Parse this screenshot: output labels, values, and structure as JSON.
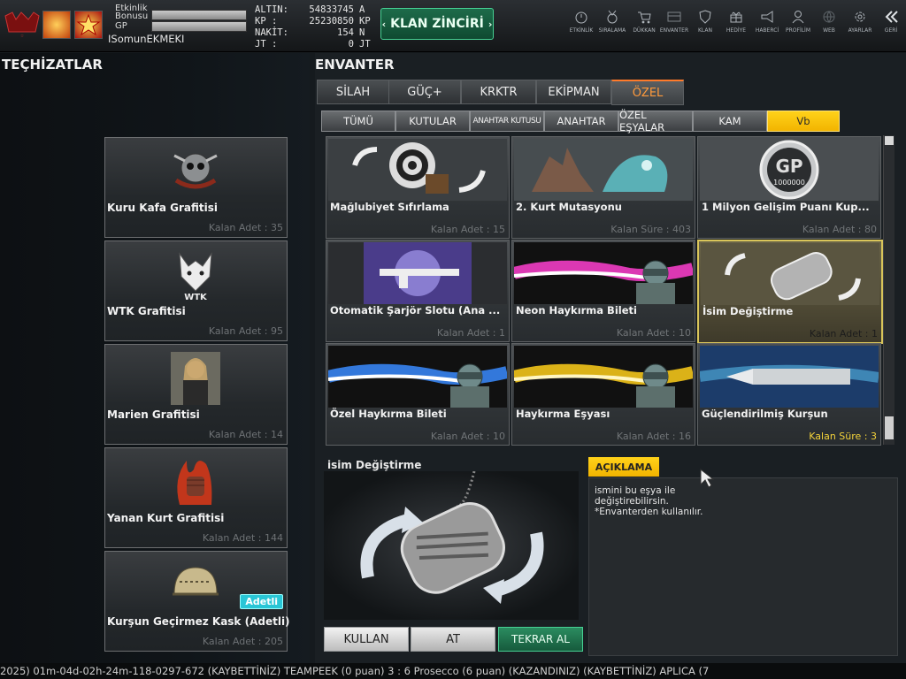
{
  "player": {
    "name": "ISomunEKMEKI",
    "bonus_label_1": "Etkinlik",
    "bonus_label_2": "Bonusu",
    "gp_label": "GP"
  },
  "currency": [
    {
      "label": "ALTIN:",
      "value": "54833745",
      "unit": "A"
    },
    {
      "label": "KP :",
      "value": "25230850",
      "unit": "KP"
    },
    {
      "label": "NAKİT:",
      "value": "154",
      "unit": "N"
    },
    {
      "label": "JT :",
      "value": "0",
      "unit": "JT"
    }
  ],
  "klan_button": {
    "label": "KLAN ZİNCİRİ"
  },
  "nav": [
    {
      "label": "ETKİNLİK",
      "icon": "stopwatch-icon"
    },
    {
      "label": "SIRALAMA",
      "icon": "medal-icon"
    },
    {
      "label": "DÜKKAN",
      "icon": "cart-icon"
    },
    {
      "label": "ENVANTER",
      "icon": "inventory-icon"
    },
    {
      "label": "KLAN",
      "icon": "shield-icon"
    },
    {
      "label": "HEDİYE",
      "icon": "gift-icon"
    },
    {
      "label": "HABERCİ",
      "icon": "megaphone-icon"
    },
    {
      "label": "PROFİLİM",
      "icon": "profile-icon"
    },
    {
      "label": "WEB",
      "icon": "globe-icon"
    },
    {
      "label": "AYARLAR",
      "icon": "gear-icon"
    },
    {
      "label": "GERİ",
      "icon": "back-icon"
    }
  ],
  "left": {
    "title": "TEÇHİZATLAR",
    "items": [
      {
        "name": "Kuru Kafa Grafitisi",
        "qty": "Kalan Adet : 35",
        "icon": "skull-icon"
      },
      {
        "name": "WTK Grafitisi",
        "qty": "Kalan Adet : 95",
        "icon": "wolf-icon"
      },
      {
        "name": "Marien Grafitisi",
        "qty": "Kalan Adet : 14",
        "icon": "portrait-icon"
      },
      {
        "name": "Yanan Kurt Grafitisi",
        "qty": "Kalan Adet : 144",
        "icon": "flame-fist-icon"
      },
      {
        "name": "Kurşun Geçirmez Kask (Adetli)",
        "qty": "Kalan Adet : 205",
        "badge": "Adetli",
        "icon": "helmet-icon"
      }
    ]
  },
  "inventory": {
    "title": "ENVANTER",
    "tabs": [
      "SİLAH",
      "GÜÇ+",
      "KRKTR",
      "EKİPMAN",
      "ÖZEL"
    ],
    "active_tab": "ÖZEL",
    "subtabs": [
      "TÜMÜ",
      "KUTULAR",
      "ANAHTAR KUTUSU",
      "ANAHTAR",
      "ÖZEL EŞYALAR",
      "KAM",
      "Vb"
    ],
    "active_subtab": "Vb",
    "items": [
      {
        "name": "Mağlubiyet  Sıfırlama",
        "qty": "Kalan Adet : 15",
        "art": "target-reset"
      },
      {
        "name": "2. Kurt Mutasyonu",
        "qty": "Kalan Süre : 403",
        "art": "werewolf"
      },
      {
        "name": "1 Milyon Gelişim Puanı Kup...",
        "qty": "Kalan Adet : 80",
        "art": "gp-coin",
        "coin_text": "GP",
        "coin_sub": "1000000"
      },
      {
        "name": "Otomatik Şarjör Slotu (Ana ...",
        "qty": "Kalan Adet : 1",
        "art": "rifle-slot"
      },
      {
        "name": "Neon Haykırma Bileti",
        "qty": "Kalan Adet : 10",
        "art": "neon-shout"
      },
      {
        "name": "İsim Değiştirme",
        "qty": "Kalan Adet : 1",
        "art": "dogtag",
        "selected": true
      },
      {
        "name": "Özel Haykırma Bileti",
        "qty": "Kalan Adet : 10",
        "art": "blue-shout"
      },
      {
        "name": "Haykırma Eşyası",
        "qty": "Kalan Adet : 16",
        "art": "gold-shout"
      },
      {
        "name": "Güçlendirilmiş Kurşun",
        "qty": "Kalan Süre : 3",
        "art": "bullet",
        "qty_highlight": true
      }
    ]
  },
  "selected": {
    "name": "isim Değiştirme",
    "desc_header": "AÇIKLAMA",
    "desc_lines": [
      "ismini bu eşya ile",
      "değiştirebilirsin.",
      "*Envanterden kullanılır."
    ]
  },
  "actions": {
    "use": "KULLAN",
    "drop": "AT",
    "repeat": "TEKRAR AL"
  },
  "ticker": "2025) 01m-04d-02h-24m-118-0297-672  (KAYBETTİNİZ) TEAMPEEK (0 puan) 3 : 6 Prosecco (6 puan) (KAZANDINIZ)              (KAYBETTİNİZ) APLICA (7",
  "colors": {
    "accent_green": "#1d6b4a",
    "accent_yellow": "#f2b400",
    "accent_orange": "#ff7a2a"
  }
}
